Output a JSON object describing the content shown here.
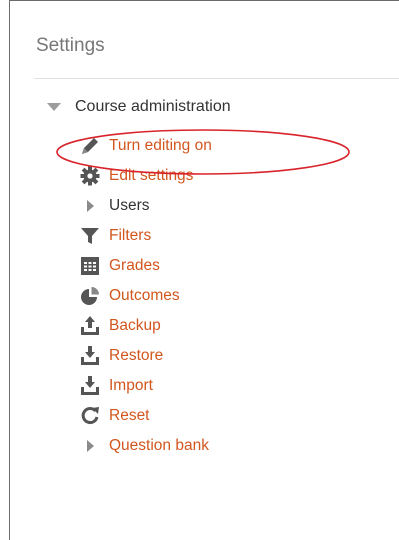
{
  "panel": {
    "title": "Settings"
  },
  "tree": {
    "header_label": "Course administration",
    "items": [
      {
        "label": "Turn editing on",
        "icon": "pencil-icon"
      },
      {
        "label": "Edit settings",
        "icon": "gear-icon"
      },
      {
        "label": "Users",
        "icon": "caret-right-icon"
      },
      {
        "label": "Filters",
        "icon": "filter-icon"
      },
      {
        "label": "Grades",
        "icon": "grades-table-icon"
      },
      {
        "label": "Outcomes",
        "icon": "pie-chart-icon"
      },
      {
        "label": "Backup",
        "icon": "upload-icon"
      },
      {
        "label": "Restore",
        "icon": "download-icon"
      },
      {
        "label": "Import",
        "icon": "download-icon"
      },
      {
        "label": "Reset",
        "icon": "reset-icon"
      },
      {
        "label": "Question bank",
        "icon": "caret-right-icon"
      }
    ]
  },
  "colors": {
    "link": "#d2561e",
    "text": "#333333",
    "icon": "#555555",
    "highlight_ring": "#d9232b"
  }
}
